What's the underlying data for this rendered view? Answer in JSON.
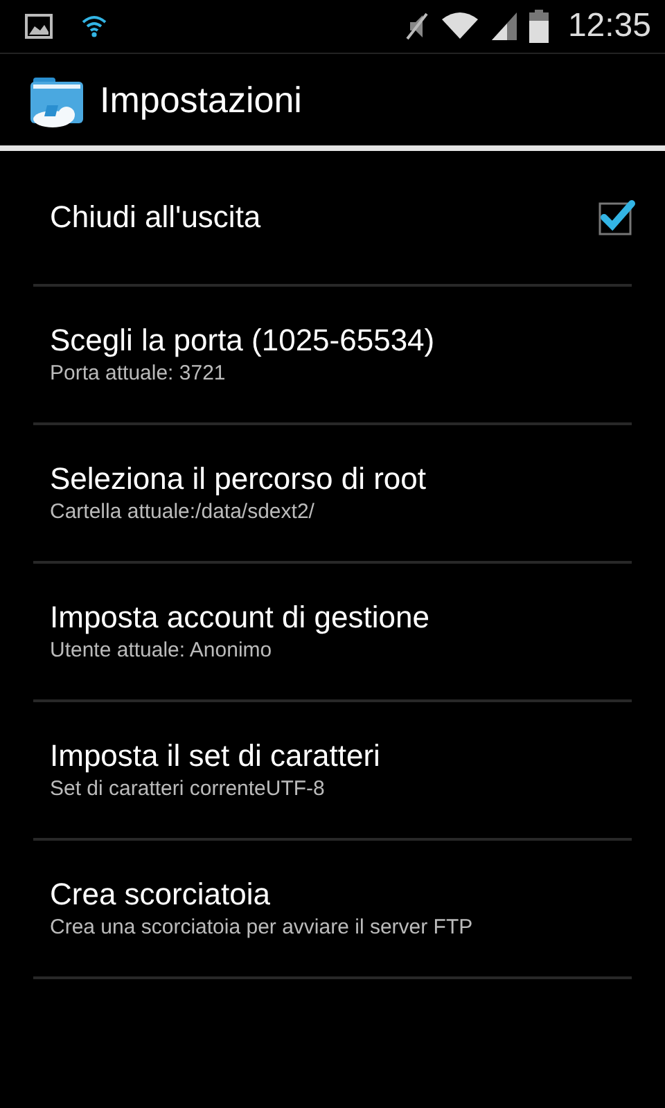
{
  "status_bar": {
    "time": "12:35"
  },
  "action_bar": {
    "title": "Impostazioni"
  },
  "settings": [
    {
      "kind": "checkbox",
      "title": "Chiudi all'uscita",
      "checked": true
    },
    {
      "kind": "plain",
      "title": "Scegli la porta (1025-65534)",
      "summary": "Porta attuale: 3721"
    },
    {
      "kind": "plain",
      "title": "Seleziona il percorso di root",
      "summary": "Cartella attuale:/data/sdext2/"
    },
    {
      "kind": "plain",
      "title": "Imposta account di gestione",
      "summary": "Utente attuale: Anonimo"
    },
    {
      "kind": "plain",
      "title": "Imposta il set di caratteri",
      "summary": "Set di caratteri correnteUTF-8"
    },
    {
      "kind": "plain",
      "title": "Crea scorciatoia",
      "summary": "Crea una scorciatoia per avviare il server FTP"
    }
  ]
}
